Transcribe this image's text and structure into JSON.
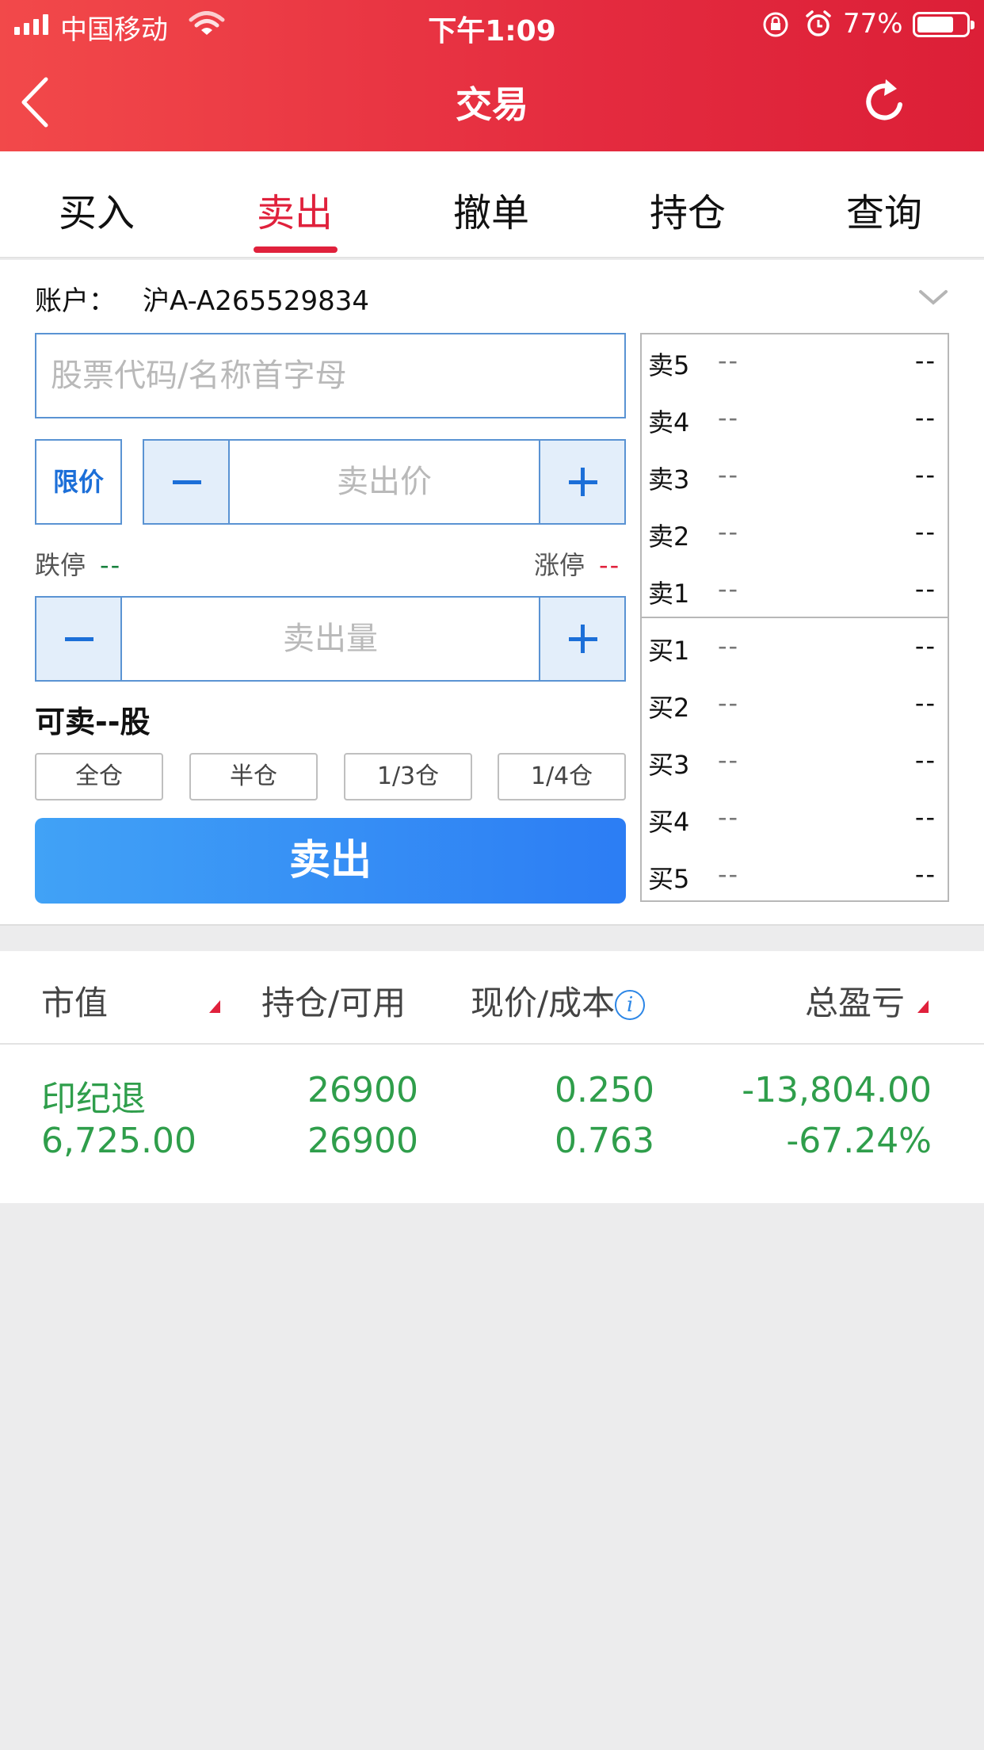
{
  "status": {
    "carrier": "中国移动",
    "time": "下午1:09",
    "battery_pct": "77%",
    "battery_level": 0.77
  },
  "nav": {
    "title": "交易"
  },
  "tabs": [
    {
      "label": "买入",
      "active": false
    },
    {
      "label": "卖出",
      "active": true
    },
    {
      "label": "撤单",
      "active": false
    },
    {
      "label": "持仓",
      "active": false
    },
    {
      "label": "查询",
      "active": false
    }
  ],
  "account": {
    "label": "账户：",
    "value": "沪A-A265529834"
  },
  "form": {
    "code_placeholder": "股票代码/名称首字母",
    "price_type": "限价",
    "price_placeholder": "卖出价",
    "limit_down_label": "跌停",
    "limit_down_value": "--",
    "limit_up_label": "涨停",
    "limit_up_value": "--",
    "qty_placeholder": "卖出量",
    "sellable": "可卖--股",
    "ratios": [
      "全仓",
      "半仓",
      "1/3仓",
      "1/4仓"
    ],
    "submit_label": "卖出"
  },
  "order_book": {
    "asks": [
      {
        "label": "卖5",
        "price": "--",
        "volume": "--"
      },
      {
        "label": "卖4",
        "price": "--",
        "volume": "--"
      },
      {
        "label": "卖3",
        "price": "--",
        "volume": "--"
      },
      {
        "label": "卖2",
        "price": "--",
        "volume": "--"
      },
      {
        "label": "卖1",
        "price": "--",
        "volume": "--"
      }
    ],
    "bids": [
      {
        "label": "买1",
        "price": "--",
        "volume": "--"
      },
      {
        "label": "买2",
        "price": "--",
        "volume": "--"
      },
      {
        "label": "买3",
        "price": "--",
        "volume": "--"
      },
      {
        "label": "买4",
        "price": "--",
        "volume": "--"
      },
      {
        "label": "买5",
        "price": "--",
        "volume": "--"
      }
    ]
  },
  "holdings": {
    "headers": {
      "market_value": "市值",
      "position": "持仓/可用",
      "price_cost": "现价/成本",
      "total_pl": "总盈亏"
    },
    "rows": [
      {
        "name": "印纪退",
        "market_value": "6,725.00",
        "position": "26900",
        "available": "26900",
        "price": "0.250",
        "cost": "0.763",
        "pl": "-13,804.00",
        "pl_pct": "-67.24%"
      }
    ]
  },
  "colors": {
    "brand_red": "#e0213c",
    "accent_blue": "#2c7df4",
    "gain_green": "#2f9e4b"
  }
}
